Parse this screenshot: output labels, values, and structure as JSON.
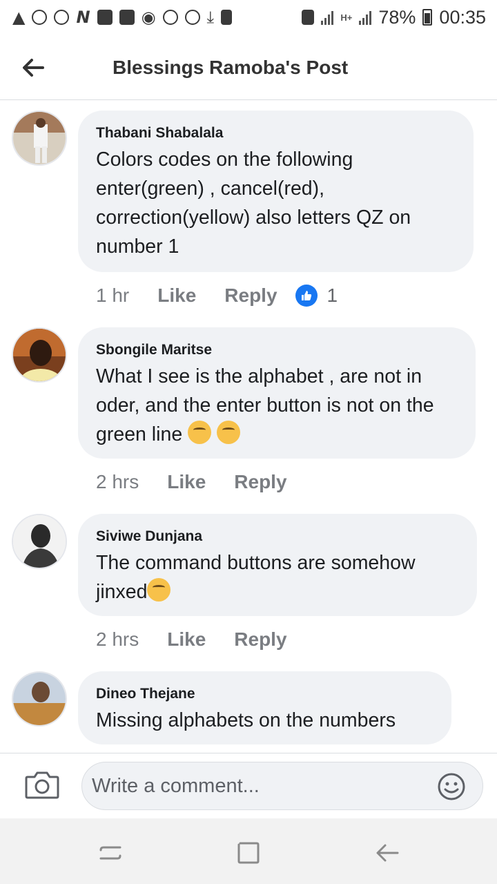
{
  "status_bar": {
    "battery": "78%",
    "time": "00:35",
    "network_label": "H+"
  },
  "header": {
    "title": "Blessings Ramoba's Post"
  },
  "comments": [
    {
      "author": "Thabani Shabalala",
      "text": "Colors codes on the following enter(green) , cancel(red), correction(yellow) also letters QZ on number 1",
      "time": "1 hr",
      "like_label": "Like",
      "reply_label": "Reply",
      "reaction_count": "1"
    },
    {
      "author": "Sbongile Maritse",
      "text": "What I see is the alphabet , are not in oder, and the enter button is not on the green line",
      "time": "2 hrs",
      "like_label": "Like",
      "reply_label": "Reply"
    },
    {
      "author": "Siviwe Dunjana",
      "text": "The command buttons are somehow jinxed",
      "time": "2 hrs",
      "like_label": "Like",
      "reply_label": "Reply"
    },
    {
      "author": "Dineo Thejane",
      "text": "Missing alphabets on the numbers"
    }
  ],
  "composer": {
    "placeholder": "Write a comment..."
  },
  "colors": {
    "bubble": "#f0f2f5",
    "like_blue": "#1877f2",
    "meta_gray": "#65676b"
  },
  "icons": {
    "back": "back-arrow-icon",
    "camera": "camera-icon",
    "emoji": "smiley-icon",
    "like": "thumbs-up-icon",
    "nav_recent": "recent-apps-icon",
    "nav_home": "home-icon",
    "nav_back": "nav-back-icon"
  }
}
